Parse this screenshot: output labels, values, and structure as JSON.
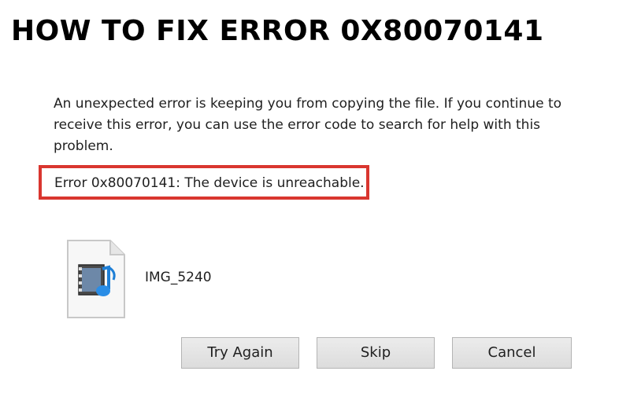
{
  "headline": "HOW TO FIX ERROR 0X80070141",
  "dialog": {
    "message": "An unexpected error is keeping you from copying the file. If you continue to receive this error, you can use the error code to search for help with this problem.",
    "error_text": "Error 0x80070141: The device is unreachable.",
    "highlight_color": "#d9362f",
    "file": {
      "icon": "media-file-icon",
      "name": "IMG_5240"
    },
    "buttons": {
      "try_again": "Try Again",
      "skip": "Skip",
      "cancel": "Cancel"
    }
  }
}
